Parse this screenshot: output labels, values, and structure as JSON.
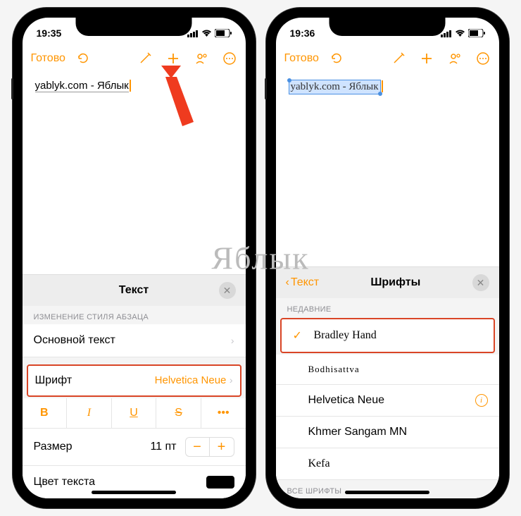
{
  "watermark": "Яблык",
  "phones": [
    {
      "status": {
        "time": "19:35"
      },
      "toolbar": {
        "done": "Готово"
      },
      "note_text": "yablyk.com - Яблык",
      "panel": {
        "title": "Текст",
        "section_label": "ИЗМЕНЕНИЕ СТИЛЯ АБЗАЦА",
        "style_row": "Основной текст",
        "font_label": "Шрифт",
        "font_value": "Helvetica Neue",
        "btn_b": "B",
        "btn_i": "I",
        "btn_u": "U",
        "btn_s": "S",
        "btn_more": "•••",
        "size_label": "Размер",
        "size_value": "11 пт",
        "color_label": "Цвет текста"
      }
    },
    {
      "status": {
        "time": "19:36"
      },
      "toolbar": {
        "done": "Готово"
      },
      "note_text": "yablyk.com - Яблык",
      "panel": {
        "back": "Текст",
        "title": "Шрифты",
        "section_recent": "НЕДАВНИЕ",
        "fonts": {
          "f0": "Bradley Hand",
          "f1": "Bodhisattva",
          "f2": "Helvetica Neue",
          "f3": "Khmer Sangam MN",
          "f4": "Kefa"
        },
        "section_all": "ВСЕ ШРИФТЫ"
      }
    }
  ]
}
